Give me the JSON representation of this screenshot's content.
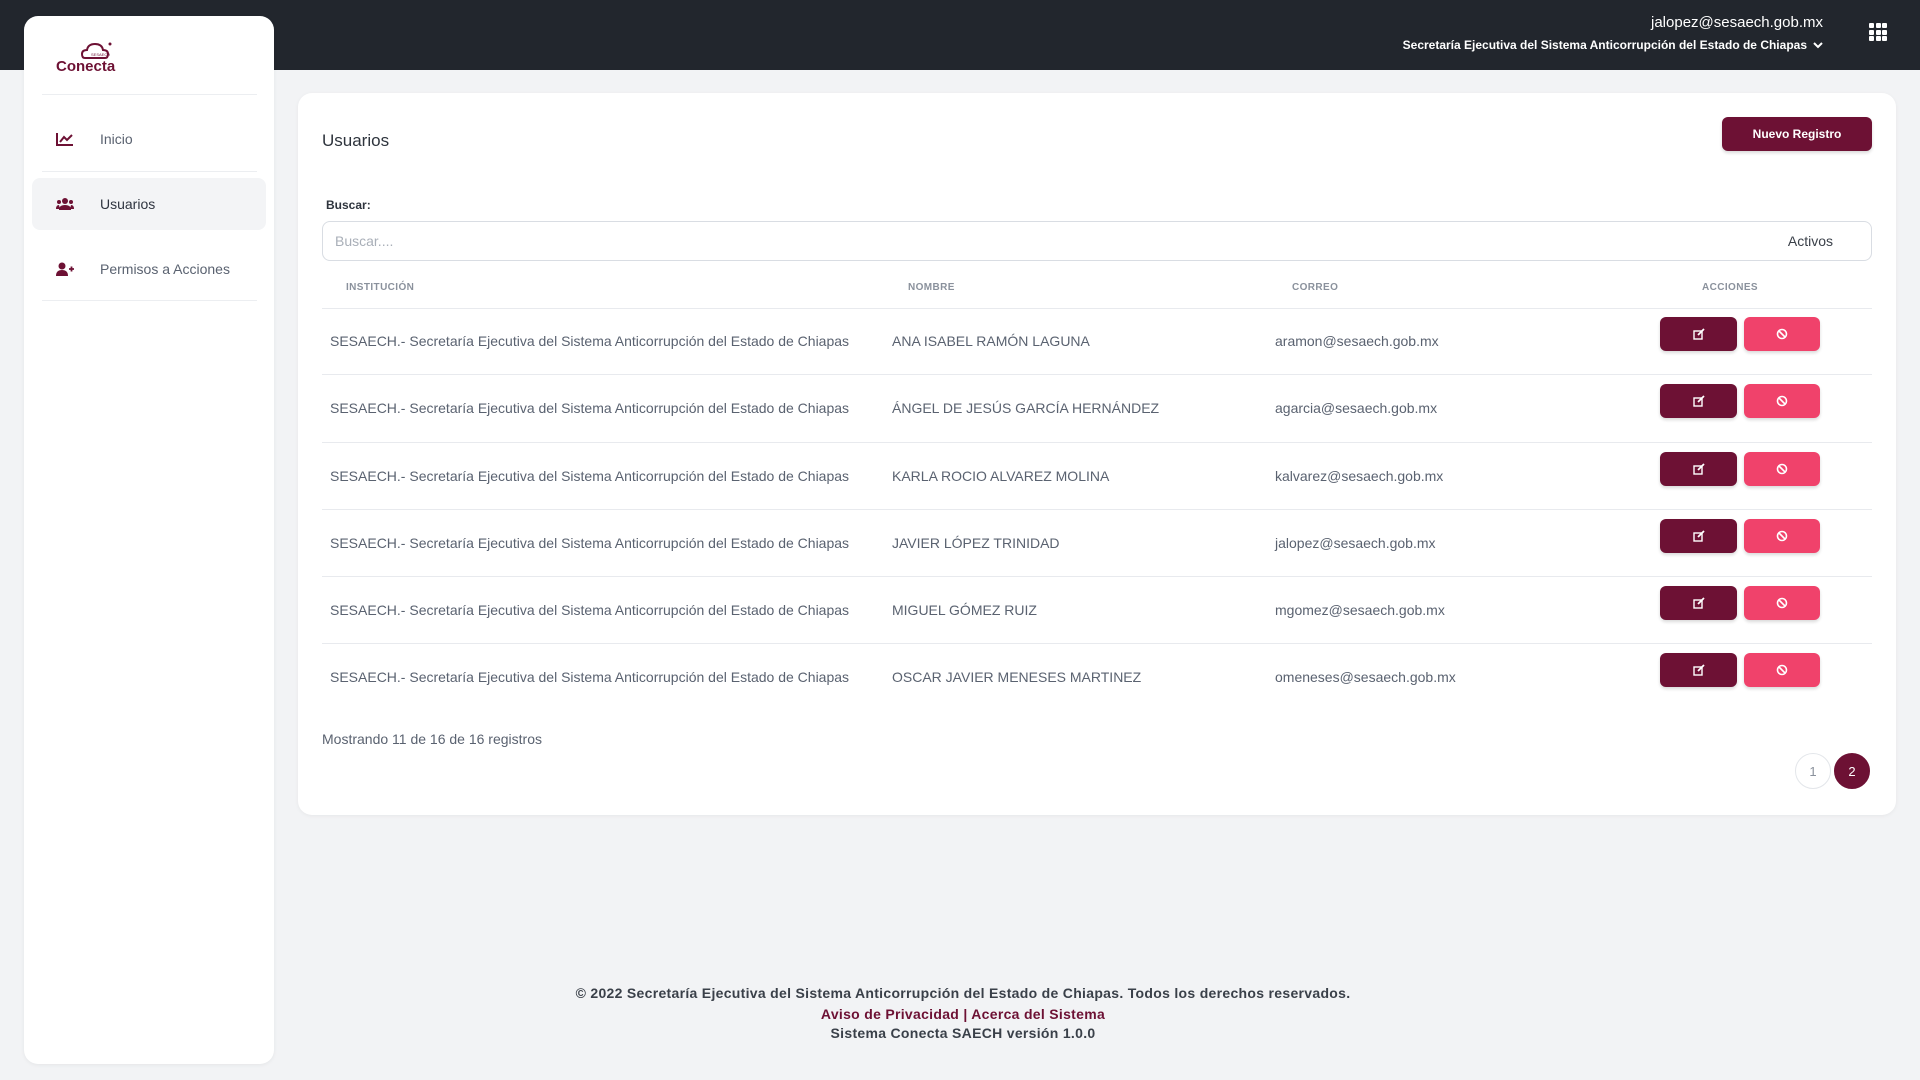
{
  "topbar": {
    "email": "jalopez@sesaech.gob.mx",
    "organization": "Secretaría Ejecutiva del Sistema Anticorrupción del Estado de Chiapas",
    "apps_icon": "grid-icon"
  },
  "brand": {
    "name": "Conecta",
    "color": "#6d1134"
  },
  "sidebar": {
    "items": [
      {
        "label": "Inicio",
        "icon": "chart-icon",
        "active": false
      },
      {
        "label": "Usuarios",
        "icon": "users-icon",
        "active": true
      },
      {
        "label": "Permisos a Acciones",
        "icon": "user-plus-icon",
        "active": false
      }
    ]
  },
  "main": {
    "title": "Usuarios",
    "new_button": "Nuevo Registro",
    "search_label": "Buscar:",
    "search_placeholder": "Buscar....",
    "search_filter": "Activos",
    "columns": [
      "INSTITUCIÓN",
      "NOMBRE",
      "CORREO",
      "ACCIONES"
    ],
    "rows": [
      {
        "institution": "SESAECH.- Secretaría Ejecutiva del Sistema Anticorrupción del Estado de Chiapas",
        "name": "ANA ISABEL RAMÓN LAGUNA",
        "email": "aramon@sesaech.gob.mx"
      },
      {
        "institution": "SESAECH.- Secretaría Ejecutiva del Sistema Anticorrupción del Estado de Chiapas",
        "name": "ÁNGEL DE JESÚS GARCÍA HERNÁNDEZ",
        "email": "agarcia@sesaech.gob.mx"
      },
      {
        "institution": "SESAECH.- Secretaría Ejecutiva del Sistema Anticorrupción del Estado de Chiapas",
        "name": "KARLA ROCIO ALVAREZ MOLINA",
        "email": "kalvarez@sesaech.gob.mx"
      },
      {
        "institution": "SESAECH.- Secretaría Ejecutiva del Sistema Anticorrupción del Estado de Chiapas",
        "name": "JAVIER LÓPEZ TRINIDAD",
        "email": "jalopez@sesaech.gob.mx"
      },
      {
        "institution": "SESAECH.- Secretaría Ejecutiva del Sistema Anticorrupción del Estado de Chiapas",
        "name": "MIGUEL GÓMEZ RUIZ",
        "email": "mgomez@sesaech.gob.mx"
      },
      {
        "institution": "SESAECH.- Secretaría Ejecutiva del Sistema Anticorrupción del Estado de Chiapas",
        "name": "OSCAR JAVIER MENESES MARTINEZ",
        "email": "omeneses@sesaech.gob.mx"
      }
    ],
    "row_actions": {
      "edit_icon": "edit-icon",
      "disable_icon": "ban-icon"
    },
    "showing": "Mostrando 11 de 16 de 16 registros",
    "pages": [
      "1",
      "2"
    ],
    "current_page": "2"
  },
  "footer": {
    "copyright": "© 2022 Secretaría Ejecutiva del Sistema Anticorrupción del Estado de Chiapas. Todos los derechos reservados.",
    "privacy": "Aviso de Privacidad",
    "separator": " | ",
    "about": "Acerca del Sistema",
    "version": "Sistema Conecta SAECH versión 1.0.0"
  },
  "colors": {
    "primary": "#6d1134",
    "danger": "#f0426b",
    "topbar": "#22262d",
    "background": "#f2f3f5"
  }
}
